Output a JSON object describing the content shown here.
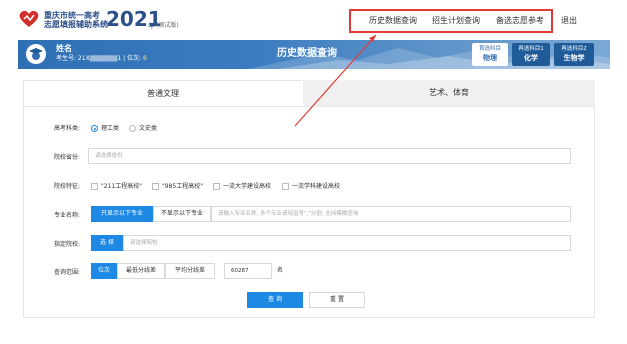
{
  "header": {
    "brand_line1": "重庆市统一高考",
    "brand_line2": "志愿填报辅助系统",
    "brand_year": "2021",
    "brand_unit": "年",
    "brand_test": "(测试版)",
    "nav": [
      "历史数据查询",
      "招生计划查询",
      "备选志愿参考"
    ],
    "logout": "退出"
  },
  "banner": {
    "user_name": "姓名",
    "exam_label": "考生号: 21X",
    "exam_tail": "1 | 位次: ",
    "rank_value": "6",
    "title": "历史数据查询",
    "subjects": [
      {
        "top": "首选科目",
        "value": "物理"
      },
      {
        "top": "再选科目1",
        "value": "化学"
      },
      {
        "top": "再选科目2",
        "value": "生物学"
      }
    ]
  },
  "tabs": {
    "active": "普通文理",
    "inactive": "艺术、体育"
  },
  "form": {
    "subject_label": "高考科类:",
    "subject_options": [
      "理工类",
      "文史类"
    ],
    "province_label": "院校省份:",
    "province_placeholder": "请选择省份",
    "feature_label": "院校特征:",
    "feature_options": [
      "\"211工程高校\"",
      "\"985工程高校\"",
      "一流大学建设高校",
      "一流学科建设高校"
    ],
    "major_label": "专业名称:",
    "major_btn_on": "只显示以下专业",
    "major_btn_off": "不显示以下专业",
    "major_placeholder": "请输入专业名称, 多个专业请用逗号\",\"分割, 支持模糊查询",
    "school_label": "指定院校:",
    "school_btn": "选 择",
    "school_placeholder": "请选择院校",
    "range_label": "查询范围:",
    "range_btns": [
      "位次",
      "最低分线差",
      "平均分线差"
    ],
    "range_value": "60287",
    "range_unit": "名",
    "query_btn": "查 询",
    "reset_btn": "重 置"
  },
  "colors": {
    "accent": "#1e88e5",
    "brand": "#2b4f8a",
    "annotation": "#e53935"
  }
}
